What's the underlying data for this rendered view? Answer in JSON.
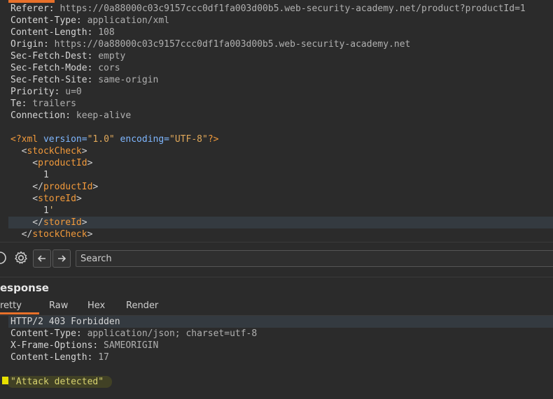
{
  "request": {
    "headers": [
      {
        "name": "Referer:",
        "value": " https://0a88000c03c9157ccc0df1fa003d00b5.web-security-academy.net/product?productId=1"
      },
      {
        "name": "Content-Type:",
        "value": " application/xml"
      },
      {
        "name": "Content-Length:",
        "value": " 108"
      },
      {
        "name": "Origin:",
        "value": " https://0a88000c03c9157ccc0df1fa003d00b5.web-security-academy.net"
      },
      {
        "name": "Sec-Fetch-Dest:",
        "value": " empty"
      },
      {
        "name": "Sec-Fetch-Mode:",
        "value": " cors"
      },
      {
        "name": "Sec-Fetch-Site:",
        "value": " same-origin"
      },
      {
        "name": "Priority:",
        "value": " u=0"
      },
      {
        "name": "Te:",
        "value": " trailers"
      },
      {
        "name": "Connection:",
        "value": " keep-alive"
      }
    ],
    "xml": {
      "decl_open": "<?xml ",
      "ver_attr": "version=",
      "ver_val": "\"1.0\"",
      "enc_attr": " encoding=",
      "enc_val": "\"UTF-8\"",
      "decl_close": "?>",
      "stock_open": "stockCheck",
      "product_tag": "productId",
      "product_value": "1",
      "store_tag": "storeId",
      "store_value": "1",
      "store_value_suffix": "'",
      "stock_close": "stockCheck"
    }
  },
  "toolbar": {
    "search_placeholder": "Search"
  },
  "response": {
    "title": "esponse",
    "tabs": [
      "retty",
      "Raw",
      "Hex",
      "Render"
    ],
    "status_line": "HTTP/2 403 Forbidden",
    "headers": [
      {
        "name": "Content-Type:",
        "value": " application/json; charset=utf-8"
      },
      {
        "name": "X-Frame-Options:",
        "value": " SAMEORIGIN"
      },
      {
        "name": "Content-Length:",
        "value": " 17"
      }
    ],
    "body": "\"Attack detected\""
  },
  "colors": {
    "accent": "#e8702a",
    "xml_tag": "#f29a3b",
    "xml_attr": "#7fb7ff",
    "json_string": "#d8d36f",
    "marker": "#e8e000"
  }
}
